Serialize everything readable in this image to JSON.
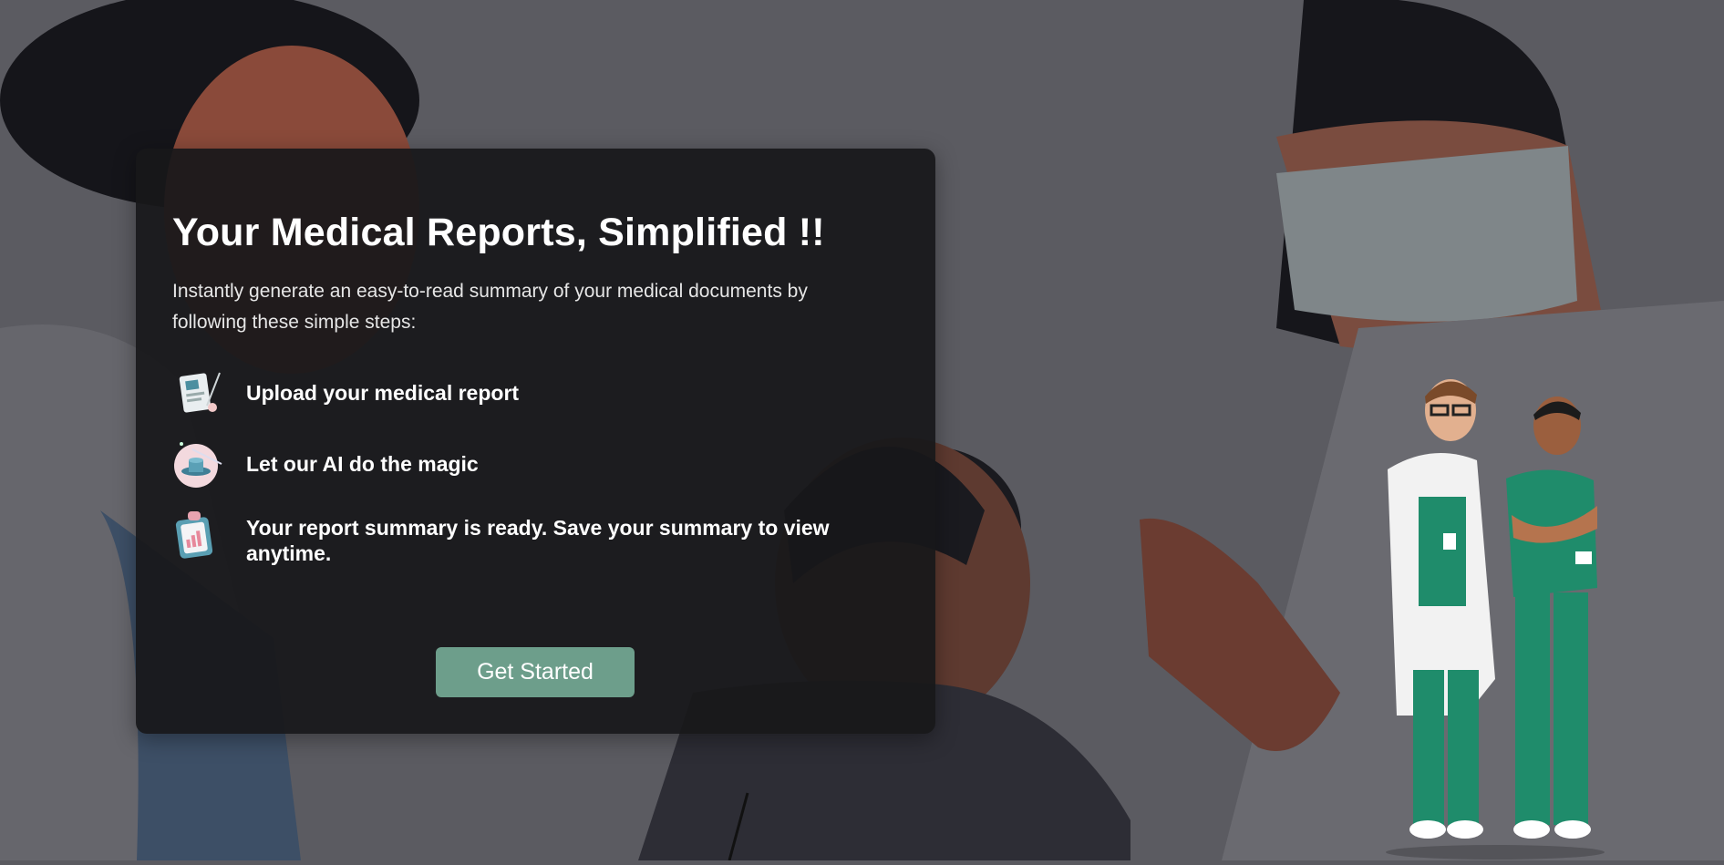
{
  "hero": {
    "title": "Your Medical Reports, Simplified !!",
    "subtitle": "Instantly generate an easy-to-read summary of your medical documents by following these simple steps:"
  },
  "steps": [
    {
      "icon": "report-icon",
      "label": "Upload your medical report"
    },
    {
      "icon": "magic-hat-icon",
      "label": "Let our AI do the magic"
    },
    {
      "icon": "clipboard-chart-icon",
      "label": "Your report summary is ready. Save your summary to view anytime."
    }
  ],
  "cta": {
    "label": "Get Started"
  },
  "colors": {
    "accent": "#6d9e8b",
    "card": "#18181a",
    "scrubs": "#1f8c6b"
  }
}
